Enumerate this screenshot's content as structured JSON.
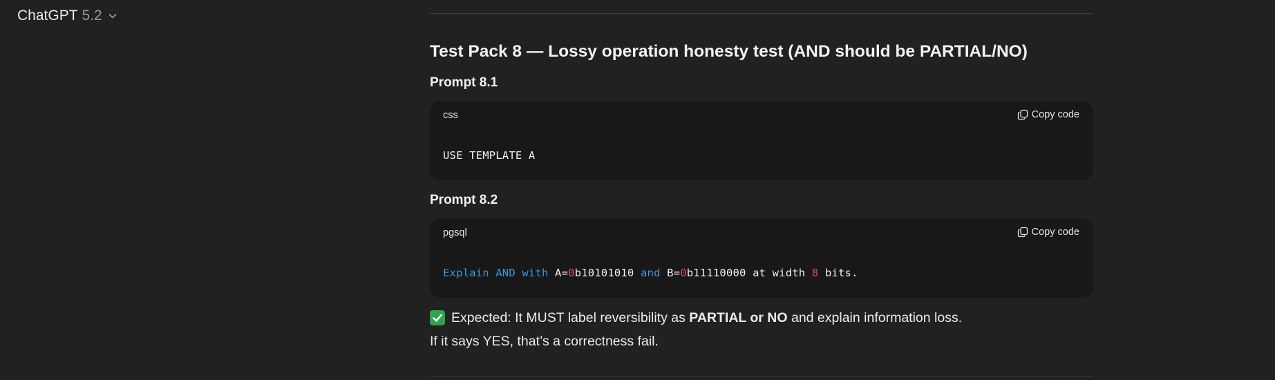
{
  "header": {
    "model_name": "ChatGPT",
    "model_version": "5.2"
  },
  "section": {
    "title": "Test Pack 8 — Lossy operation honesty test (AND should be PARTIAL/NO)"
  },
  "prompts": [
    {
      "heading": "Prompt 8.1",
      "code_language": "css",
      "copy_label": "Copy code",
      "code_tokens": [
        {
          "text": "USE TEMPLATE A",
          "kind": "plain"
        }
      ]
    },
    {
      "heading": "Prompt 8.2",
      "code_language": "pgsql",
      "copy_label": "Copy code",
      "code_tokens": [
        {
          "text": "Explain AND with",
          "kind": "keyword"
        },
        {
          "text": " A=",
          "kind": "plain"
        },
        {
          "text": "0",
          "kind": "number"
        },
        {
          "text": "b10101010 ",
          "kind": "plain"
        },
        {
          "text": "and",
          "kind": "keyword"
        },
        {
          "text": " B=",
          "kind": "plain"
        },
        {
          "text": "0",
          "kind": "number"
        },
        {
          "text": "b11110000 at width ",
          "kind": "plain"
        },
        {
          "text": "8",
          "kind": "number"
        },
        {
          "text": " bits.",
          "kind": "plain"
        }
      ]
    }
  ],
  "expected": {
    "icon": "check-mark-icon",
    "prefix": "Expected: It MUST label reversibility as ",
    "emphasis": "PARTIAL or NO",
    "suffix": " and explain information loss."
  },
  "fail_note": "If it says YES, that’s a correctness fail.",
  "colors": {
    "background": "#212121",
    "code_background": "#181818",
    "keyword": "#3d98dc",
    "number": "#e0457b",
    "check_green": "#2ea44f"
  }
}
